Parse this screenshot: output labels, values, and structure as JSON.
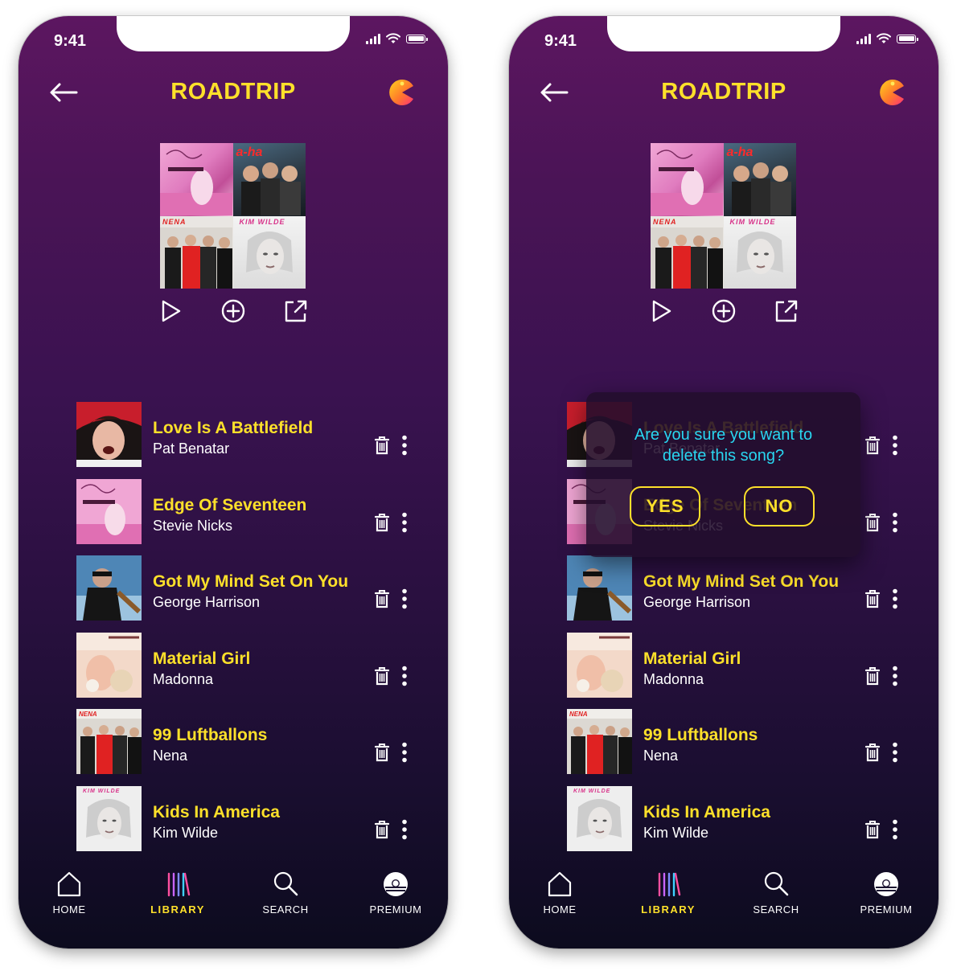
{
  "screens": [
    {
      "status": {
        "time": "9:41"
      },
      "header": {
        "title": "ROADTRIP"
      },
      "cover_labels": {
        "a": "a-ha",
        "b": "NENA",
        "c": "KIM WILDE"
      },
      "songs": [
        {
          "title": "Love Is A Battlefield",
          "artist": "Pat Benatar"
        },
        {
          "title": "Edge Of Seventeen",
          "artist": "Stevie Nicks"
        },
        {
          "title": "Got My Mind Set On You",
          "artist": "George Harrison"
        },
        {
          "title": "Material Girl",
          "artist": "Madonna"
        },
        {
          "title": "99 Luftballons",
          "artist": "Nena"
        },
        {
          "title": "Kids In America",
          "artist": "Kim Wilde"
        }
      ],
      "tabs": {
        "home": "HOME",
        "library": "LIBRARY",
        "search": "SEARCH",
        "premium": "PREMIUM"
      }
    },
    {
      "status": {
        "time": "9:41"
      },
      "header": {
        "title": "ROADTRIP"
      },
      "cover_labels": {
        "a": "a-ha",
        "b": "NENA",
        "c": "KIM WILDE"
      },
      "songs": [
        {
          "title": "Love Is A Battlefield",
          "artist": "Pat Benatar"
        },
        {
          "title": "Edge Of Seventeen",
          "artist": "Stevie Nicks"
        },
        {
          "title": "Got My Mind Set On You",
          "artist": "George Harrison"
        },
        {
          "title": "Material Girl",
          "artist": "Madonna"
        },
        {
          "title": "99 Luftballons",
          "artist": "Nena"
        },
        {
          "title": "Kids In America",
          "artist": "Kim Wilde"
        }
      ],
      "tabs": {
        "home": "HOME",
        "library": "LIBRARY",
        "search": "SEARCH",
        "premium": "PREMIUM"
      },
      "dialog": {
        "line1": "Are you sure you want to",
        "line2": "delete this song?",
        "yes": "YES",
        "no": "NO"
      }
    }
  ],
  "colors": {
    "accent": "#fde02a",
    "dialog_text": "#29d6f0",
    "background_top": "#5c1660",
    "background_bottom": "#0c0b1e"
  }
}
